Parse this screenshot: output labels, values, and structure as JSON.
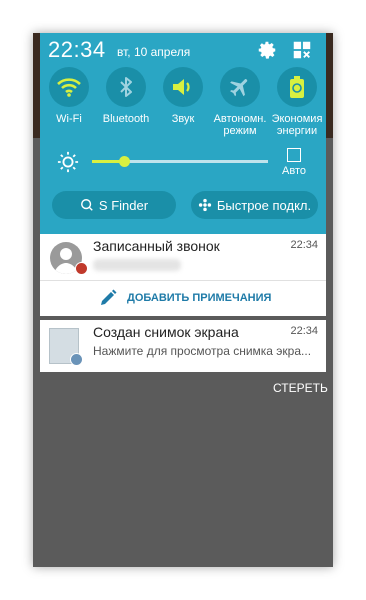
{
  "status": {
    "time": "22:34",
    "date": "вт, 10 апреля"
  },
  "header_icons": {
    "settings": "gear-icon",
    "edit": "grid-icon"
  },
  "toggles": [
    {
      "label": "Wi-Fi",
      "icon": "wifi-icon"
    },
    {
      "label": "Bluetooth",
      "icon": "bluetooth-icon"
    },
    {
      "label": "Звук",
      "icon": "sound-icon"
    },
    {
      "label": "Автономн. режим",
      "icon": "airplane-icon"
    },
    {
      "label": "Экономия энергии",
      "icon": "power-saving-icon"
    }
  ],
  "brightness": {
    "level": 0.18,
    "auto_label": "Авто"
  },
  "buttons": {
    "sfinder": "S Finder",
    "quick_connect": "Быстрое подкл."
  },
  "notifications": [
    {
      "title": "Записанный звонок",
      "time": "22:34",
      "action": "ДОБАВИТЬ ПРИМЕЧАНИЯ"
    },
    {
      "title": "Создан снимок экрана",
      "time": "22:34",
      "subtitle": "Нажмите для просмотра снимка экра..."
    }
  ],
  "clear_label": "СТЕРЕТЬ",
  "colors": {
    "panel": "#2aa6c4",
    "active_accent": "#d8f040",
    "shade": "#5b5b5b"
  }
}
